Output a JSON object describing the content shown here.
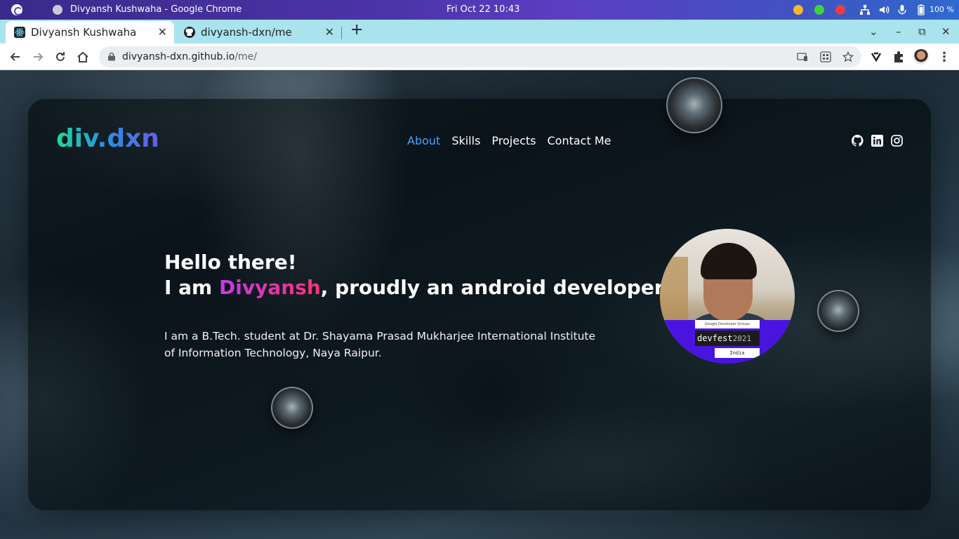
{
  "os": {
    "window_title": "Divyansh Kushwaha - Google Chrome",
    "clock": "Fri Oct 22  10:43",
    "battery": "100 %"
  },
  "browser": {
    "tabs": [
      {
        "label": "Divyansh Kushwaha",
        "active": true,
        "favicon": "react-icon"
      },
      {
        "label": "divyansh-dxn/me",
        "active": false,
        "favicon": "github-icon"
      }
    ],
    "url_host": "divyansh-dxn.github.io",
    "url_path": "/me/"
  },
  "site": {
    "logo": "div.dxn",
    "nav": [
      {
        "label": "About",
        "active": true
      },
      {
        "label": "Skills",
        "active": false
      },
      {
        "label": "Projects",
        "active": false
      },
      {
        "label": "Contact Me",
        "active": false
      }
    ],
    "social_icons": [
      "github-icon",
      "linkedin-icon",
      "instagram-icon"
    ],
    "hero": {
      "greeting": "Hello there!",
      "intro_prefix": "I am ",
      "name": "Divyansh",
      "intro_suffix": ", proudly an android developer.",
      "bio": "I am a B.Tech. student at Dr. Shayama Prasad Mukharjee International Institute of Information Technology, Naya Raipur."
    },
    "avatar": {
      "gdg": "Google Developer Groups",
      "devfest": "devfest",
      "year": "2021",
      "region": "India"
    }
  },
  "colors": {
    "tabstrip": "#a9e3ee",
    "nav_active": "#4aa3ff",
    "name_gradient_start": "#c43be0",
    "name_gradient_end": "#ff2f7a"
  }
}
